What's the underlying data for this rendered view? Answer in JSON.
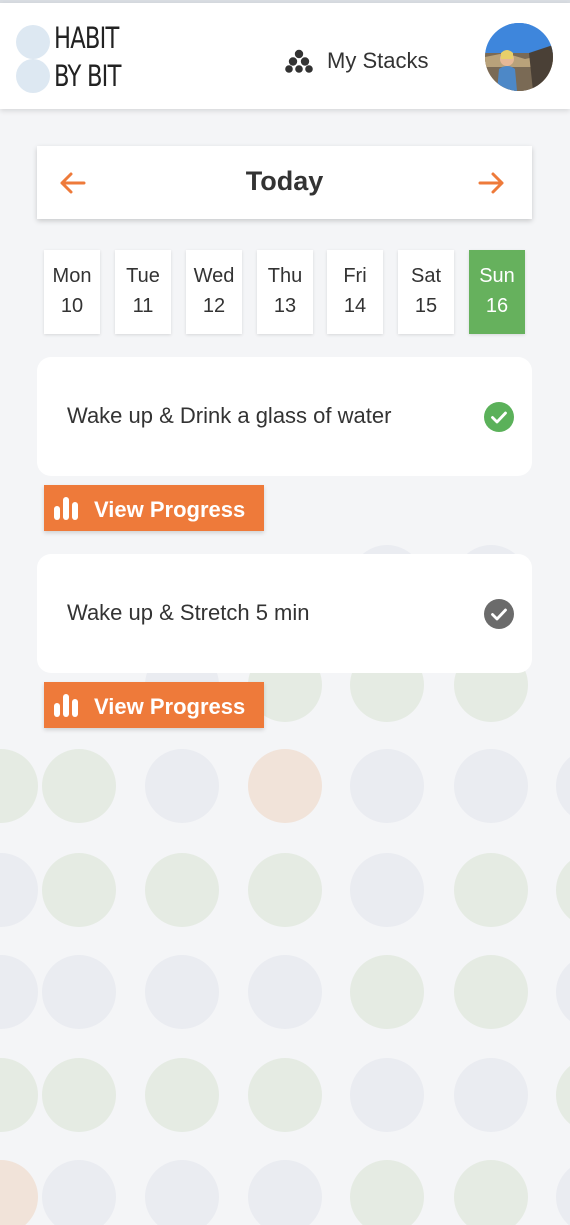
{
  "header": {
    "logo_line1": "HABIT",
    "logo_line2": "BY BIT",
    "nav_stacks_label": "My Stacks",
    "avatar_icon": "profile-photo"
  },
  "date_nav": {
    "title": "Today",
    "prev_icon": "arrow-left-icon",
    "next_icon": "arrow-right-icon"
  },
  "days": [
    {
      "name": "Mon",
      "num": "10",
      "active": false
    },
    {
      "name": "Tue",
      "num": "11",
      "active": false
    },
    {
      "name": "Wed",
      "num": "12",
      "active": false
    },
    {
      "name": "Thu",
      "num": "13",
      "active": false
    },
    {
      "name": "Fri",
      "num": "14",
      "active": false
    },
    {
      "name": "Sat",
      "num": "15",
      "active": false
    },
    {
      "name": "Sun",
      "num": "16",
      "active": true
    }
  ],
  "habits": [
    {
      "name": "Wake up & Drink a glass of water",
      "completed": true,
      "check_color": "#5bb15a"
    },
    {
      "name": "Wake up & Stretch 5 min",
      "completed": false,
      "check_color": "#6b6b6b"
    }
  ],
  "progress_button_label": "View Progress",
  "colors": {
    "accent": "#ee7a3a",
    "active_day": "#66b15d",
    "background": "#f4f5f7"
  }
}
